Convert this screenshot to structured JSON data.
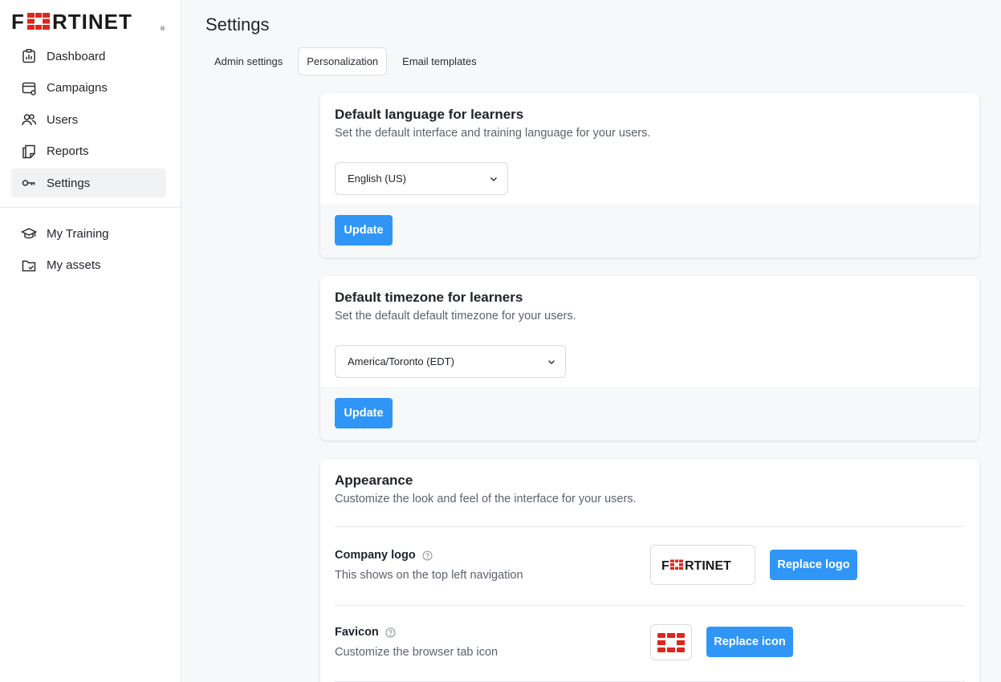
{
  "brand": {
    "logo_text": "FORTINET",
    "accent_red": "#da291c",
    "primary_blue": "#2f96f7"
  },
  "sidebar": {
    "items": [
      {
        "label": "Dashboard",
        "icon": "dashboard-icon"
      },
      {
        "label": "Campaigns",
        "icon": "campaigns-icon"
      },
      {
        "label": "Users",
        "icon": "users-icon"
      },
      {
        "label": "Reports",
        "icon": "reports-icon"
      },
      {
        "label": "Settings",
        "icon": "key-icon",
        "active": true
      }
    ],
    "secondary_items": [
      {
        "label": "My Training",
        "icon": "graduation-cap-icon"
      },
      {
        "label": "My assets",
        "icon": "folder-check-icon"
      }
    ]
  },
  "page": {
    "title": "Settings"
  },
  "tabs": [
    {
      "label": "Admin settings"
    },
    {
      "label": "Personalization",
      "active": true
    },
    {
      "label": "Email templates"
    }
  ],
  "language_card": {
    "title": "Default language for learners",
    "description": "Set the default interface and training language for your users.",
    "selected": "English (US)",
    "button": "Update"
  },
  "timezone_card": {
    "title": "Default timezone for learners",
    "description": "Set the default default timezone for your users.",
    "selected": "America/Toronto (EDT)",
    "button": "Update"
  },
  "appearance_card": {
    "title": "Appearance",
    "description": "Customize the look and feel of the interface for your users.",
    "company_logo": {
      "title": "Company logo",
      "description": "This shows on the top left navigation",
      "button": "Replace logo"
    },
    "favicon": {
      "title": "Favicon",
      "description": "Customize the browser tab icon",
      "button": "Replace icon"
    }
  }
}
